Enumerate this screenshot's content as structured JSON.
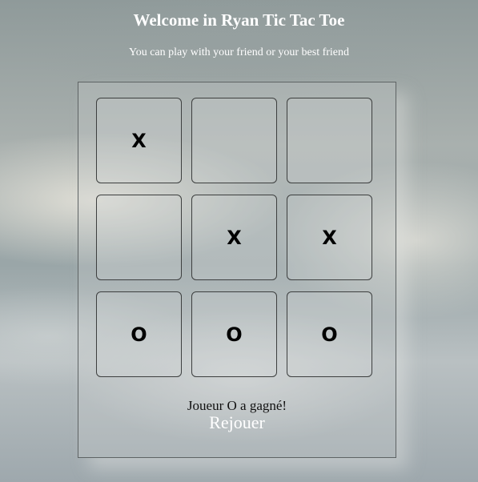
{
  "header": {
    "title": "Welcome in Ryan Tic Tac Toe",
    "subtitle": "You can play with your friend or your best friend"
  },
  "board": {
    "cells": [
      "X",
      "",
      "",
      "",
      "X",
      "X",
      "O",
      "O",
      "O"
    ]
  },
  "status": {
    "message": "Joueur O a gagné!"
  },
  "actions": {
    "replay_label": "Rejouer"
  }
}
